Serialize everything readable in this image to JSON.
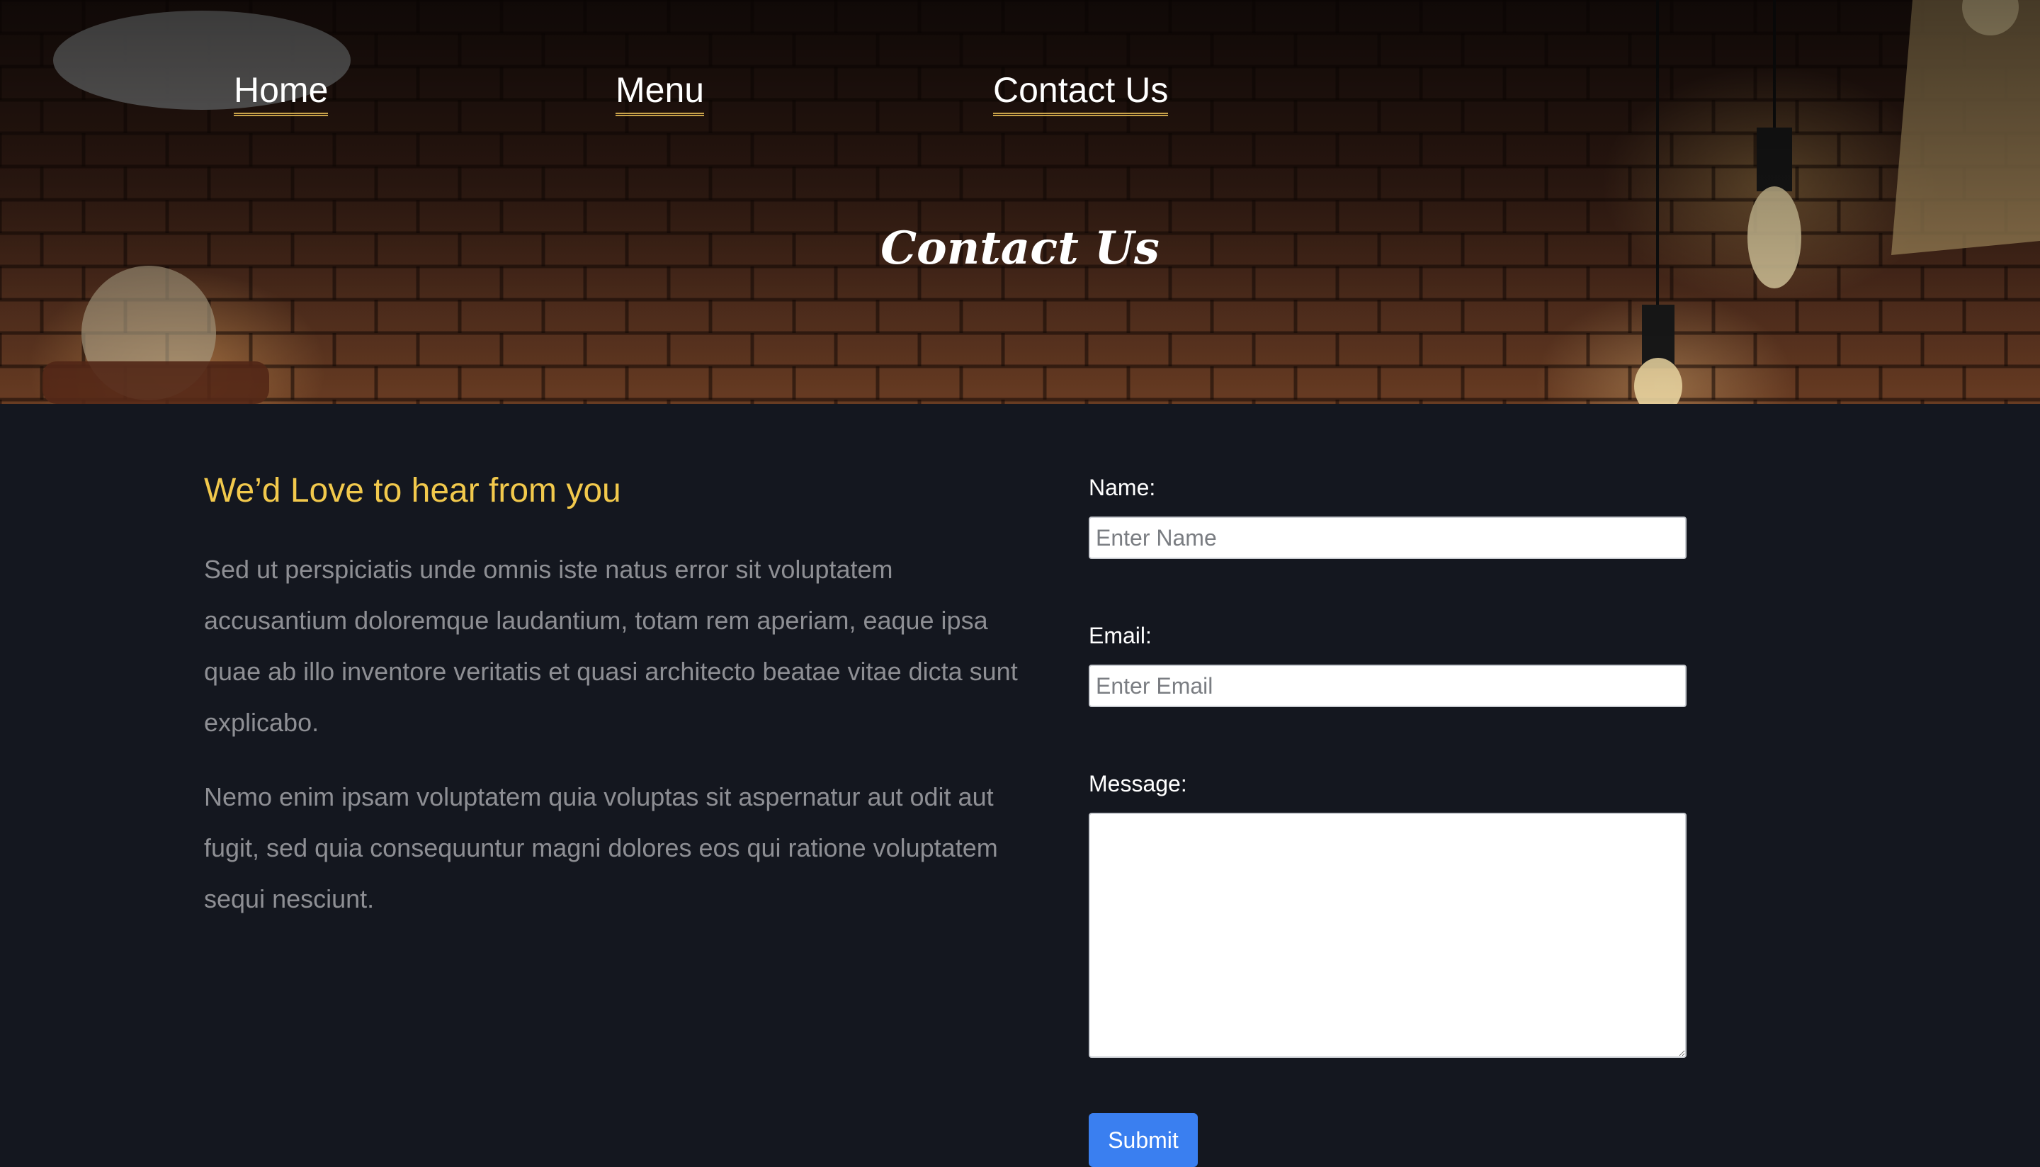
{
  "nav": {
    "items": [
      {
        "label": "Home"
      },
      {
        "label": "Menu"
      },
      {
        "label": "Contact Us"
      }
    ]
  },
  "hero": {
    "title": "Contact Us",
    "background": "brick-wall-with-hanging-lightbulbs"
  },
  "intro": {
    "heading": "We’d Love to hear from you",
    "paragraphs": [
      "Sed ut perspiciatis unde omnis iste natus error sit voluptatem accusantium doloremque laudantium, totam rem aperiam, eaque ipsa quae ab illo inventore veritatis et quasi architecto beatae vitae dicta sunt explicabo.",
      "Nemo enim ipsam voluptatem quia voluptas sit aspernatur aut odit aut fugit, sed quia consequuntur magni dolores eos qui ratione voluptatem sequi nesciunt."
    ]
  },
  "form": {
    "name_label": "Name:",
    "name_placeholder": "Enter Name",
    "name_value": "",
    "email_label": "Email:",
    "email_placeholder": "Enter Email",
    "email_value": "",
    "message_label": "Message:",
    "message_value": "",
    "submit_label": "Submit"
  },
  "colors": {
    "page_background": "#14171f",
    "heading_accent": "#f2c94c",
    "nav_underline": "#c8a24a",
    "body_text": "#8e8f94",
    "submit_button": "#3a7ff0"
  }
}
